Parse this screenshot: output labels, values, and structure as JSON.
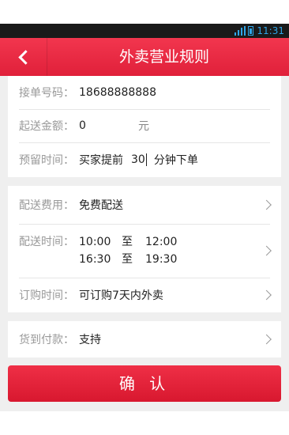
{
  "status_bar": {
    "time": "11:31",
    "icons": [
      "signal-icon",
      "battery-icon"
    ]
  },
  "header": {
    "title": "外卖营业规则",
    "back_icon": "chevron-left-icon"
  },
  "colors": {
    "accent": "#e8283f",
    "background": "#efefef",
    "label": "#999999"
  },
  "section1": {
    "phone_label": "接单号码：",
    "phone_value": "18688888888",
    "amount_label": "起送金额：",
    "amount_value": "0",
    "amount_unit": "元",
    "reserve_label": "预留时间：",
    "reserve_prefix": "买家提前",
    "reserve_value": "30",
    "reserve_suffix": "分钟下单"
  },
  "section2": {
    "fee_label": "配送费用：",
    "fee_value": "免费配送",
    "time_label": "配送时间：",
    "time_ranges": [
      {
        "start": "10:00",
        "to": "至",
        "end": "12:00"
      },
      {
        "start": "16:30",
        "to": "至",
        "end": "19:30"
      }
    ],
    "order_label": "订购时间：",
    "order_value": "可订购7天内外卖"
  },
  "section3": {
    "cod_label": "货到付款：",
    "cod_value": "支持"
  },
  "confirm_label": "确 认"
}
